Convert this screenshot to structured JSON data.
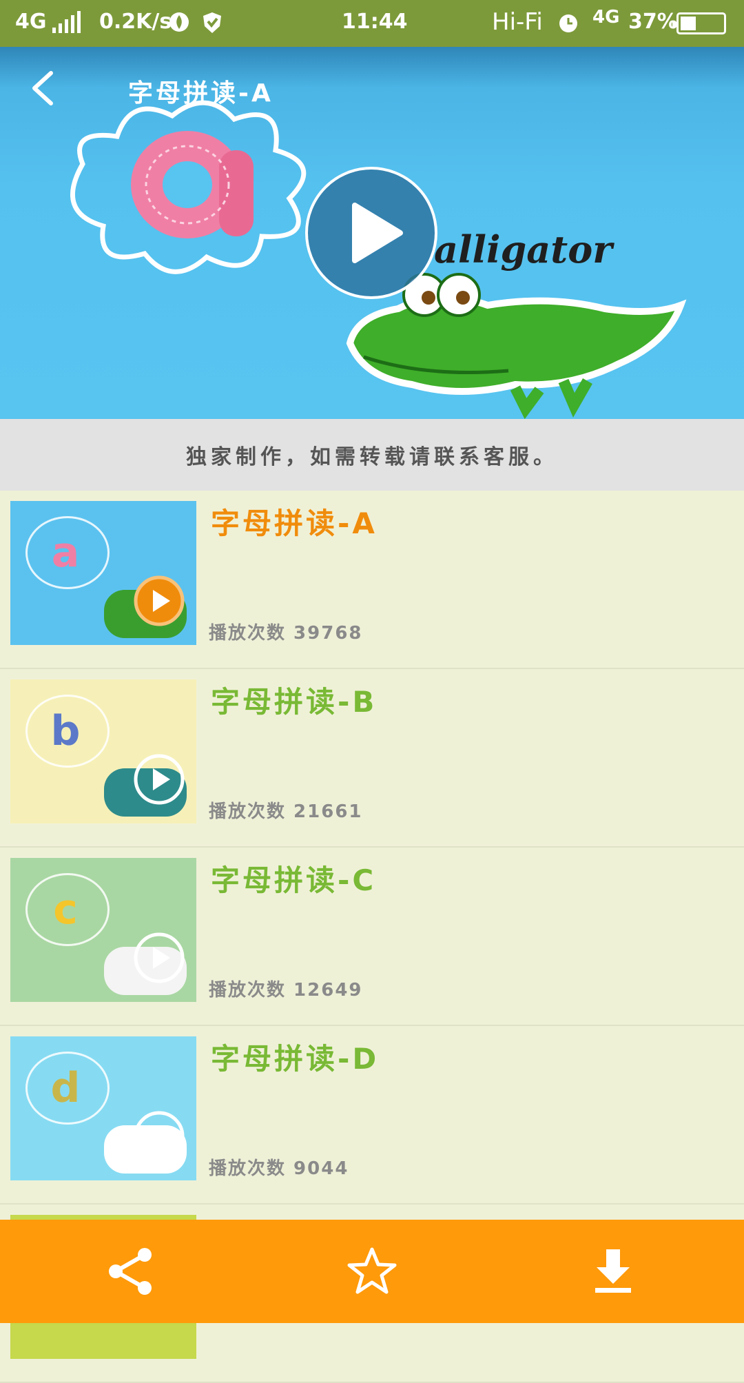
{
  "status_bar": {
    "network_left": "4G",
    "speed": "0.2K/s",
    "time": "11:44",
    "hifi": "Hi-Fi",
    "network_right": "4G",
    "battery": "37%",
    "battery_level": 0.37
  },
  "player": {
    "title": "字母拼读-A",
    "word": "alligator"
  },
  "notice": "独家制作，如需转载请联系客服。",
  "videos": [
    {
      "title": "字母拼读-A",
      "plays": "播放次数 39768",
      "letter": "a",
      "title_color": "#f08c0c",
      "thumb_bg": "#5bc2ef",
      "letter_color": "#f07fa5",
      "pic_color": "#3a9e2f",
      "active": true
    },
    {
      "title": "字母拼读-B",
      "plays": "播放次数 21661",
      "letter": "b",
      "title_color": "#79b935",
      "thumb_bg": "#f6f0b8",
      "letter_color": "#5b79c8",
      "pic_color": "#2e8b8b",
      "active": false
    },
    {
      "title": "字母拼读-C",
      "plays": "播放次数 12649",
      "letter": "c",
      "title_color": "#79b935",
      "thumb_bg": "#a9d7a3",
      "letter_color": "#f5c52c",
      "pic_color": "#f4f4f4",
      "active": false
    },
    {
      "title": "字母拼读-D",
      "plays": "播放次数 9044",
      "letter": "d",
      "title_color": "#79b935",
      "thumb_bg": "#86dbf2",
      "letter_color": "#c9b64a",
      "pic_color": "#ffffff",
      "active": false
    }
  ],
  "colors": {
    "accent": "#ff9a0a",
    "status_bar": "#7d9a3a",
    "list_bg": "#eff1d7"
  },
  "actions": {
    "share_icon": "share-icon",
    "favorite_icon": "star-icon",
    "download_icon": "download-icon"
  }
}
